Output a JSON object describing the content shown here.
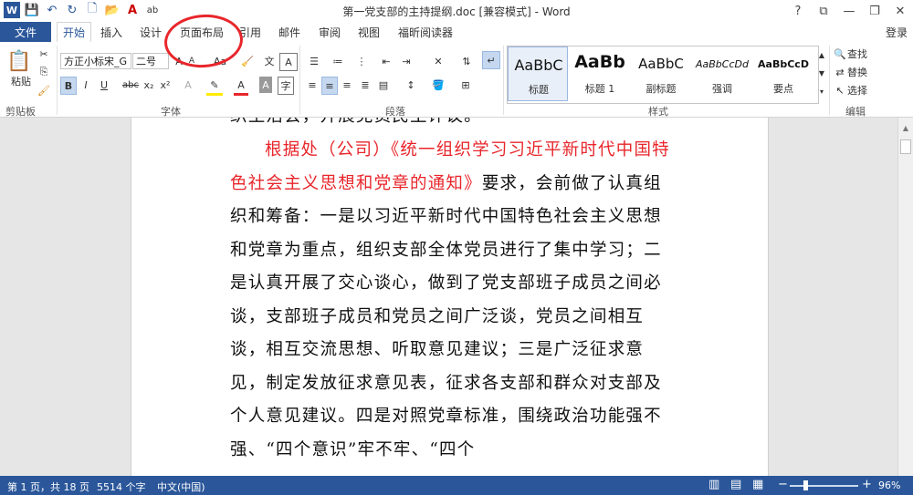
{
  "window": {
    "title": "第一党支部的主持提纲.doc [兼容模式] - Word",
    "controls": {
      "help": "?",
      "minimize": "—",
      "restore": "❐",
      "close": "✕"
    }
  },
  "ribbon_tabs": {
    "file": "文件",
    "tabs": [
      "开始",
      "插入",
      "设计",
      "页面布局",
      "引用",
      "邮件",
      "审阅",
      "视图",
      "福昕阅读器"
    ],
    "active": "开始",
    "login": "登录"
  },
  "clipboard": {
    "paste": "粘贴",
    "label": "剪贴板"
  },
  "font": {
    "family": "方正小标宋_G",
    "size": "二号",
    "label": "字体",
    "bold": "B",
    "italic": "I",
    "underline": "U",
    "strike": "abc",
    "sub": "x₂",
    "sup": "x²"
  },
  "paragraph": {
    "label": "段落"
  },
  "styles": {
    "label": "样式",
    "items": [
      {
        "sample": "AaBbC",
        "name": "标题"
      },
      {
        "sample": "AaBb",
        "name": "标题 1"
      },
      {
        "sample": "AaBbC",
        "name": "副标题"
      },
      {
        "sample": "AaBbCcDd",
        "name": "强调"
      },
      {
        "sample": "AaBbCcD",
        "name": "要点"
      }
    ]
  },
  "editing": {
    "find": "查找",
    "replace": "替换",
    "select": "选择",
    "label": "编辑"
  },
  "document": {
    "cut_line": "织生活会，开展党员民主评议。",
    "paragraph_red": "根据处（公司）《统一组织学习习近平新时代中国特色社会主义思想和党章的通知》",
    "paragraph_rest": "要求，会前做了认真组织和筹备：一是以习近平新时代中国特色社会主义思想和党章为重点，组织支部全体党员进行了集中学习；二是认真开展了交心谈心，做到了党支部班子成员之间必谈，支部班子成员和党员之间广泛谈，党员之间相互谈，相互交流思想、听取意见建议；三是广泛征求意见，制定发放征求意见表，征求各支部和群众对支部及个人意见建议。四是对照党章标准，围绕政治功能强不强、“四个意识”牢不牢、“四个"
  },
  "status": {
    "page": "第 1 页，共 18 页",
    "words": "5514 个字",
    "language": "中文(中国)",
    "zoom": "96%"
  },
  "colors": {
    "accent": "#2b579a",
    "red_text": "#e8262b"
  }
}
